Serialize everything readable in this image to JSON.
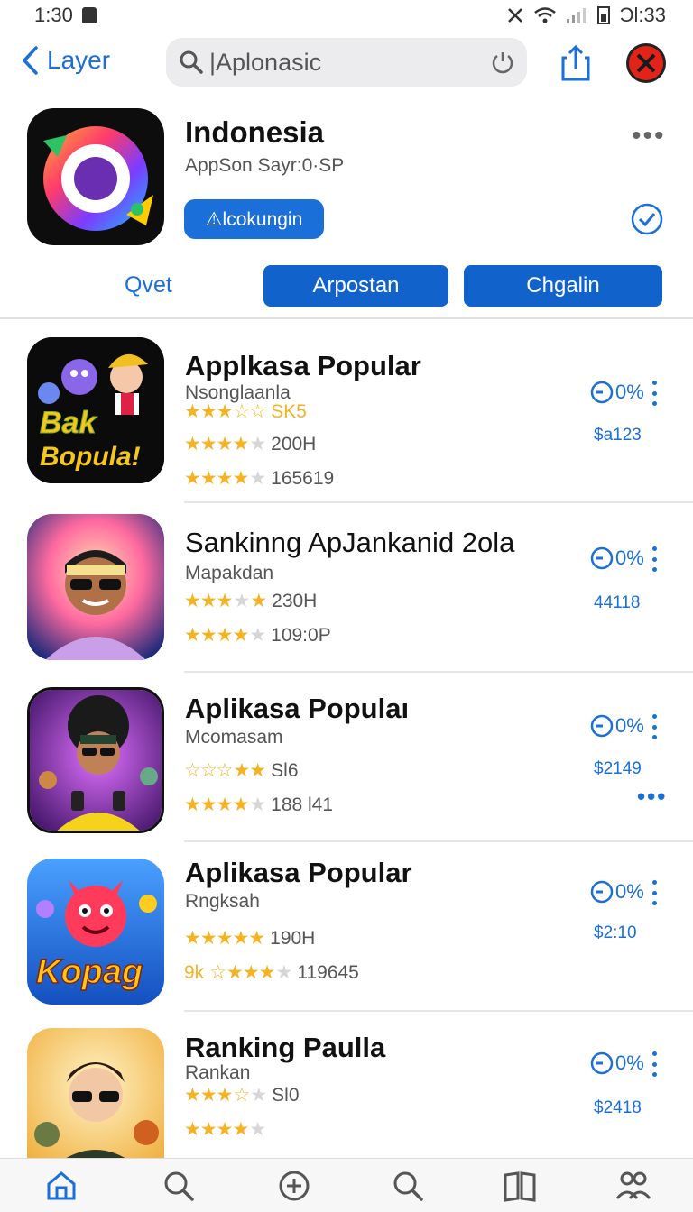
{
  "status_bar": {
    "time": "1:30",
    "right_time": "Ɔl:33"
  },
  "header": {
    "back_label": "Layer",
    "search_value": "|Aplonasic",
    "search_placeholder": ""
  },
  "hero": {
    "title": "Indonesia",
    "subtitle": "AppSon Sayr:0·SP",
    "action_label": "⚠lcokungin",
    "tab_plain": "Qvet",
    "tab_1": "Arpostan",
    "tab_2": "Chgalin"
  },
  "apps": [
    {
      "title": "Applkasa Popular",
      "sub": "Nsonglaanla",
      "r1_text": "SK5",
      "r2_text": "200H",
      "r3_text": "165619",
      "pct": "0%",
      "price": "$a123",
      "icon_text": "Bak Bopula!"
    },
    {
      "title": "Sankinng ApJankanid 2ola",
      "sub": "Mapakdan",
      "r1_text": "230H",
      "r2_text": "109:0P",
      "pct": "0%",
      "price": "44118"
    },
    {
      "title": "Aplikasa Populaı",
      "sub": "Mcomasam",
      "r1_text": "Sl6",
      "r2_text": "188 l41",
      "pct": "0%",
      "price": "$2149"
    },
    {
      "title": "Aplikasa Popular",
      "sub": "Rngksah",
      "r1_text": "190H",
      "r2_prefix": "9k",
      "r2_text": "119645",
      "pct": "0%",
      "price": "$2:10",
      "icon_text": "Kopag"
    },
    {
      "title": "Ranking Paulla",
      "sub": "Rankan",
      "r1_text": "Sl0",
      "pct": "0%",
      "price": "$2418"
    }
  ],
  "colors": {
    "accent": "#1a6fd8",
    "star": "#f5b324",
    "close_red": "#e2231a"
  },
  "icons": [
    "search-icon",
    "power-icon",
    "share-icon",
    "close-icon",
    "check-circle-icon",
    "home-icon",
    "add-icon",
    "book-icon",
    "people-icon"
  ]
}
